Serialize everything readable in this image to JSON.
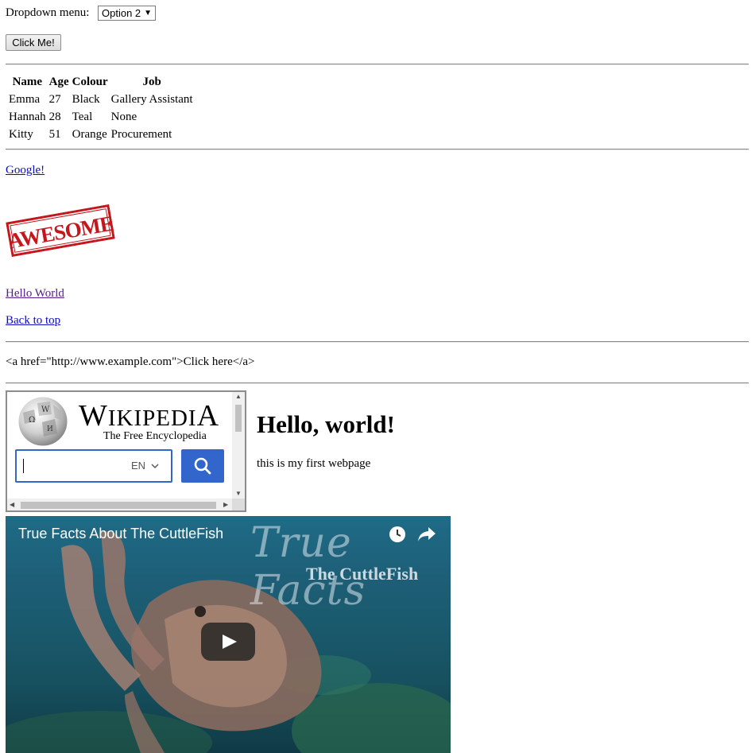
{
  "dropdown": {
    "label": "Dropdown menu:",
    "selected": "Option 2"
  },
  "button": {
    "label": "Click Me!"
  },
  "table": {
    "headers": [
      "Name",
      "Age",
      "Colour",
      "Job"
    ],
    "rows": [
      [
        "Emma",
        "27",
        "Black",
        "Gallery Assistant"
      ],
      [
        "Hannah",
        "28",
        "Teal",
        "None"
      ],
      [
        "Kitty",
        "51",
        "Orange",
        "Procurement"
      ]
    ]
  },
  "links": {
    "google": "Google!",
    "hello_world": "Hello World",
    "back_to_top": "Back to top"
  },
  "stamp_text": "AWESOME",
  "code_text": "<a href=\"http://www.example.com\">Click here</a>",
  "wikipedia": {
    "title": "Wikipedia",
    "subtitle": "The Free Encyclopedia",
    "lang": "EN",
    "search_value": ""
  },
  "heading": "Hello, world!",
  "paragraph": "this is my first webpage",
  "video": {
    "title": "True Facts About The CuttleFish",
    "overlay_line1": "True Facts",
    "overlay_line2": "The CuttleFish"
  },
  "colors": {
    "link": "#0b0bbf",
    "visited": "#551a8b",
    "wiki_blue": "#3366cc",
    "stamp_red": "#c4161c"
  },
  "icons": [
    "dropdown-arrow-icon",
    "wikipedia-globe-icon",
    "search-icon",
    "chevron-down-icon",
    "clock-icon",
    "share-icon",
    "play-icon"
  ]
}
